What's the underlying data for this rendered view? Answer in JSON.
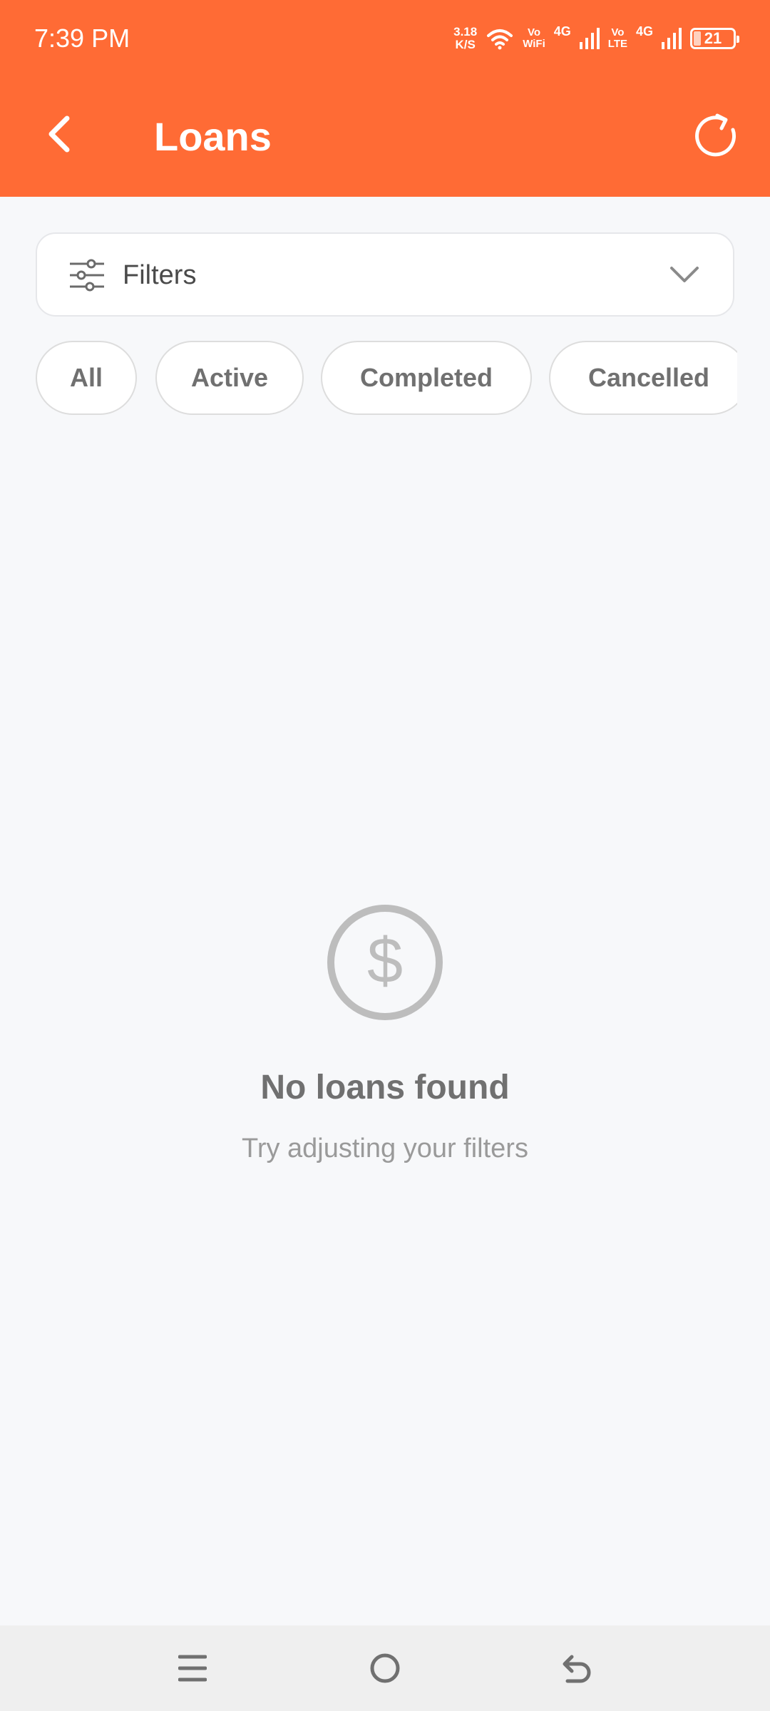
{
  "status_bar": {
    "time": "7:39 PM",
    "net_speed_value": "3.18",
    "net_speed_unit": "K/S",
    "wifi_tag_top": "Vo",
    "wifi_tag_bottom": "WiFi",
    "signal1_tag": "4G",
    "lte_tag_top": "Vo",
    "lte_tag_bottom": "LTE",
    "signal2_tag": "4G",
    "battery_level": "21",
    "icons": [
      "wifi-icon",
      "signal-icon",
      "signal-icon",
      "battery-icon"
    ]
  },
  "toolbar": {
    "title": "Loans",
    "back_icon": "chevron-left-icon",
    "refresh_icon": "refresh-icon"
  },
  "filters": {
    "label": "Filters",
    "icon": "sliders-icon",
    "chevron": "chevron-down-icon"
  },
  "chips": [
    {
      "label": "All"
    },
    {
      "label": "Active"
    },
    {
      "label": "Completed"
    },
    {
      "label": "Cancelled"
    }
  ],
  "empty_state": {
    "icon": "dollar-circle-icon",
    "title": "No loans found",
    "subtitle": "Try adjusting your filters"
  },
  "nav_bar": {
    "icons": [
      "menu-icon",
      "home-icon",
      "back-icon"
    ]
  },
  "colors": {
    "primary": "#ff6b35",
    "background": "#f7f8fa",
    "chip_text": "#707070",
    "empty_icon": "#bdbdbd"
  }
}
